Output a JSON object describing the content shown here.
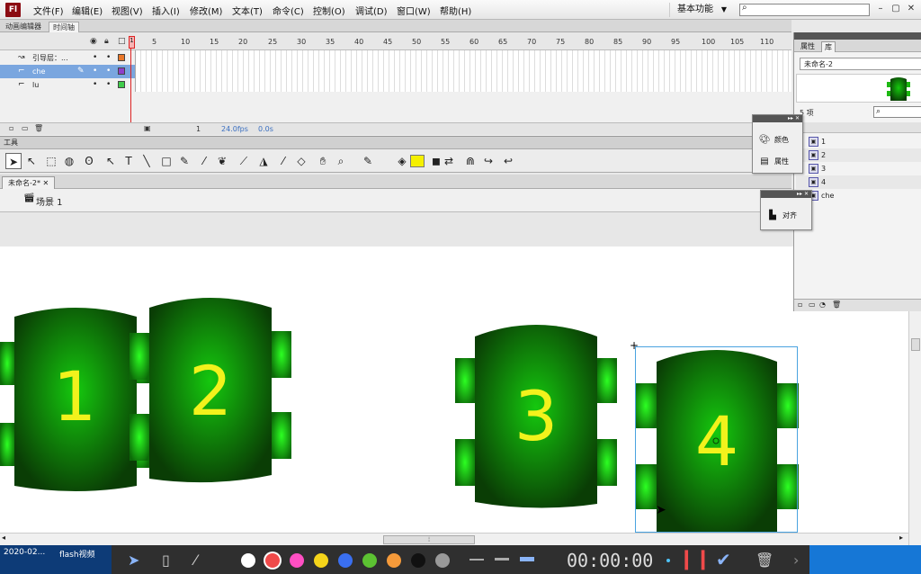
{
  "app": {
    "logo": "Fl"
  },
  "menu": [
    "文件(F)",
    "编辑(E)",
    "视图(V)",
    "插入(I)",
    "修改(M)",
    "文本(T)",
    "命令(C)",
    "控制(O)",
    "调试(D)",
    "窗口(W)",
    "帮助(H)"
  ],
  "workspace": {
    "label": "基本功能"
  },
  "panel_tabs": {
    "motion_editor": "动画编辑器",
    "timeline": "时间轴"
  },
  "timeline": {
    "frame_numbers": [
      "5",
      "10",
      "15",
      "20",
      "25",
      "30",
      "35",
      "40",
      "45",
      "50",
      "55",
      "60",
      "65",
      "70",
      "75",
      "80",
      "85",
      "90",
      "95",
      "100",
      "105",
      "110"
    ],
    "playhead_frame": "1",
    "layers": [
      {
        "name": "引导层：...",
        "color": "#e9782a"
      },
      {
        "name": "che",
        "color": "#8f3fc9"
      },
      {
        "name": "lu",
        "color": "#3fcc4a"
      }
    ],
    "footer": {
      "current_frame": "1",
      "fps": "24.0fps",
      "elapsed": "0.0s"
    }
  },
  "tools": {
    "title": "工具"
  },
  "document": {
    "tab": "未命名-2*",
    "scene": "场景 1"
  },
  "floating": {
    "color": "颜色",
    "properties": "属性",
    "align": "对齐"
  },
  "library": {
    "tab_properties": "属性",
    "tab_library": "库",
    "document": "未命名-2",
    "count": "5 项",
    "items": [
      "1",
      "2",
      "3",
      "4",
      "che"
    ]
  },
  "stage": {
    "cars": [
      {
        "label": "1"
      },
      {
        "label": "2"
      },
      {
        "label": "3"
      },
      {
        "label": "4"
      }
    ]
  },
  "taskbar": {
    "date": "2020-02...",
    "app": "flash视频"
  },
  "recorder": {
    "timer": "00:00:00",
    "colors": [
      "#ffffff",
      "#f04a4a",
      "#ff4fc3",
      "#f5d41a",
      "#3a6ff0",
      "#5cc232",
      "#f59a3a",
      "#111111",
      "#9a9a9a"
    ]
  },
  "colors": {
    "selection": "#4aa3e0",
    "car_dark": "#0a3d05",
    "car_light": "#15c80e",
    "number": "#f2f21c"
  }
}
